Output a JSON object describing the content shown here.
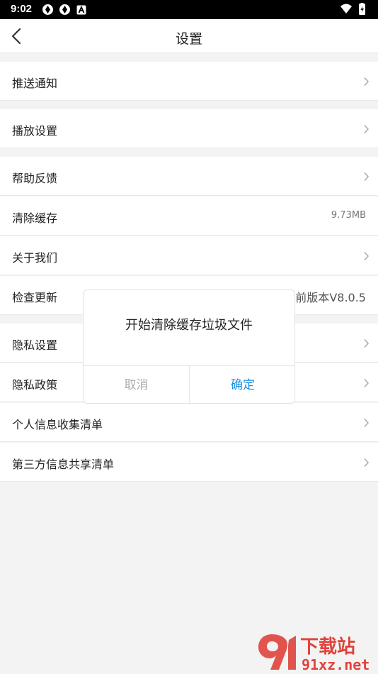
{
  "status": {
    "time": "9:02"
  },
  "header": {
    "title": "设置"
  },
  "settings": [
    {
      "label": "推送通知"
    },
    {
      "label": "播放设置"
    },
    {
      "label": "帮助反馈"
    },
    {
      "label": "清除缓存",
      "value": "9.73MB"
    },
    {
      "label": "关于我们"
    },
    {
      "label": "检查更新",
      "value": "当前版本V8.0.5"
    },
    {
      "label": "隐私设置"
    },
    {
      "label": "隐私政策"
    },
    {
      "label": "个人信息收集清单"
    },
    {
      "label": "第三方信息共享清单"
    }
  ],
  "dialog": {
    "message": "开始清除缓存垃圾文件",
    "cancel_label": "取消",
    "confirm_label": "确定"
  },
  "watermark": {
    "line1": "下载站",
    "line2": "91xz.net"
  },
  "colors": {
    "accent": "#1a8fe0",
    "watermark": "#e0433c"
  }
}
